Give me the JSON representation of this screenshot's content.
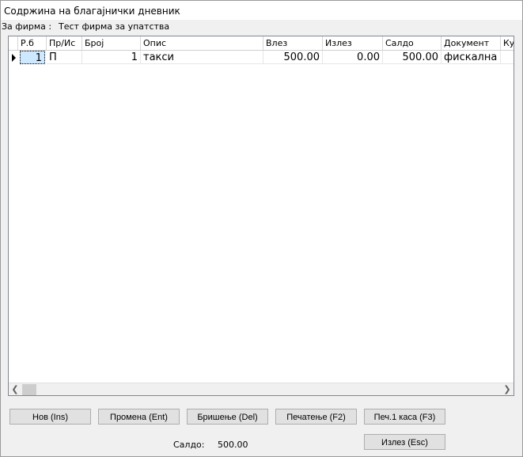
{
  "window": {
    "title": "Содржина на благајнички дневник"
  },
  "firm": {
    "label": "За фирма :",
    "value": "Тест фирма за упатства"
  },
  "table": {
    "columns": [
      "Р.б",
      "Пр/Ис",
      "Број",
      "Опис",
      "Влез",
      "Излез",
      "Салдо",
      "Документ",
      "Ку"
    ],
    "rows": [
      {
        "rb": "1",
        "pr_is": "П",
        "broj": "1",
        "opis": "такси",
        "vlez": "500.00",
        "izlez": "0.00",
        "saldo": "500.00",
        "dokument": "фискална",
        "ku": ""
      }
    ]
  },
  "scrollbar": {
    "left_icon": "chevron-left-icon",
    "right_icon": "chevron-right-icon"
  },
  "buttons": {
    "nov": "Нов (Ins)",
    "promena": "Промена (Ent)",
    "brishenje": "Бришење (Del)",
    "pechatenje": "Печатење (F2)",
    "pech_kasa": "Печ.1 каса (F3)",
    "izlez": "Излез (Esc)"
  },
  "footer": {
    "saldo_label": "Салдо:",
    "saldo_value": "500.00"
  }
}
